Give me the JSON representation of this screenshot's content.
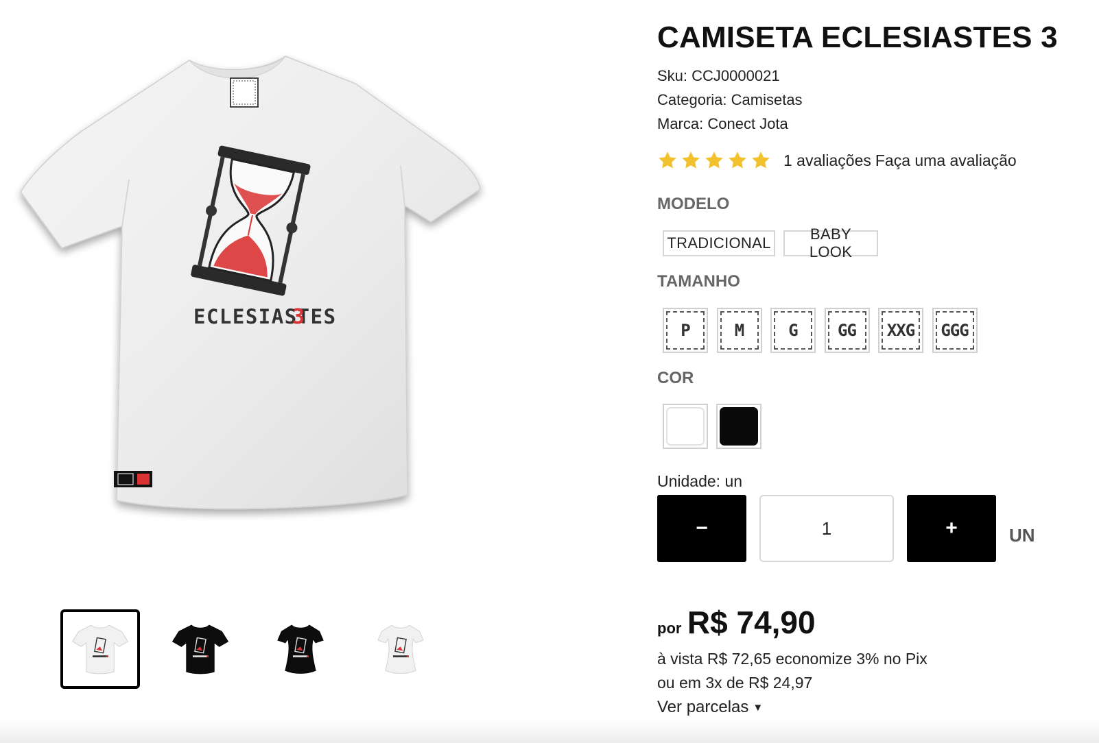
{
  "product": {
    "title": "CAMISETA ECLESIASTES 3",
    "sku_label": "Sku:",
    "sku_value": "CCJ0000021",
    "category_label": "Categoria:",
    "category_value": "Camisetas",
    "brand_label": "Marca:",
    "brand_value": "Conect Jota",
    "print_text": "ECLESIASTES",
    "print_number": "3"
  },
  "rating": {
    "stars": 5,
    "max_stars": 5,
    "count_text": "1 avaliações",
    "review_link": "Faça uma avaliação",
    "star_color": "#f2c12e"
  },
  "options": {
    "model_label": "MODELO",
    "models": [
      "TRADICIONAL",
      "BABY LOOK"
    ],
    "size_label": "TAMANHO",
    "sizes": [
      "P",
      "M",
      "G",
      "GG",
      "XXG",
      "GGG"
    ],
    "color_label": "COR",
    "colors": [
      {
        "name": "white",
        "hex": "#ffffff"
      },
      {
        "name": "black",
        "hex": "#0a0a0a"
      }
    ]
  },
  "quantity": {
    "unit_label": "Unidade: un",
    "minus": "−",
    "plus": "+",
    "value": "1",
    "unit_suffix": "UN"
  },
  "price": {
    "prefix": "por",
    "value": "R$ 74,90",
    "cash_line": "à vista R$ 72,65 economize 3% no Pix",
    "installments_line": "ou em 3x de R$ 24,97",
    "see_installments": "Ver parcelas"
  },
  "gallery": {
    "thumbnails": [
      {
        "shirt": "white",
        "cut": "tradicional",
        "selected": true
      },
      {
        "shirt": "black",
        "cut": "tradicional",
        "selected": false
      },
      {
        "shirt": "black",
        "cut": "baby-look",
        "selected": false
      },
      {
        "shirt": "white",
        "cut": "baby-look",
        "selected": false
      }
    ]
  },
  "icons": {
    "star": "star-icon",
    "caret": "caret-down-icon"
  }
}
